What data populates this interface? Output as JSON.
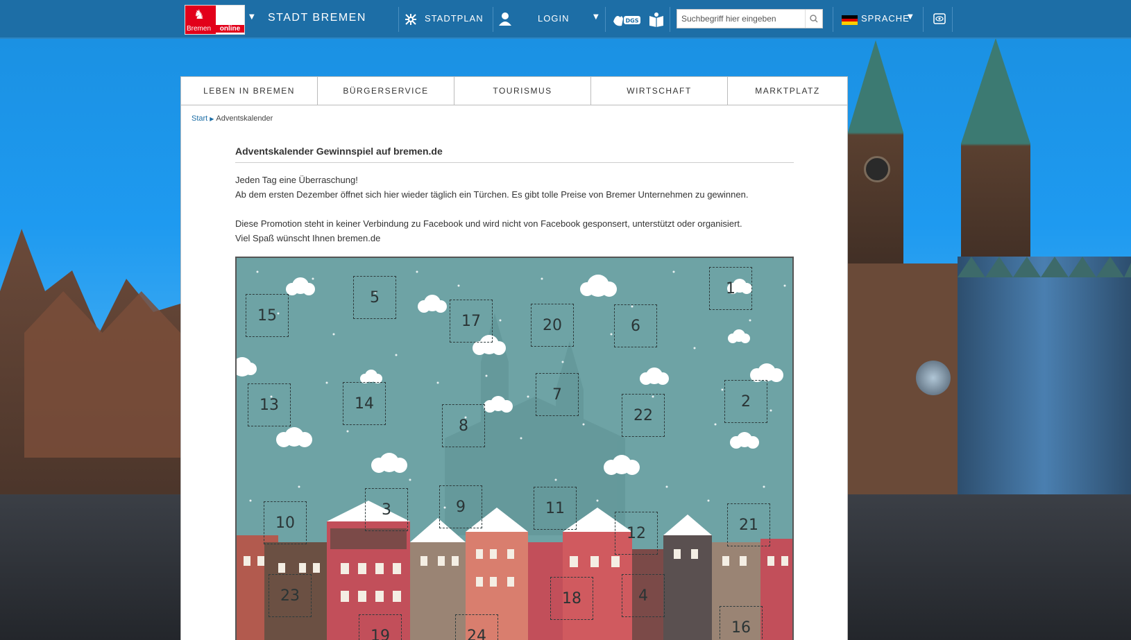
{
  "header": {
    "logo_text_left": "Bremen",
    "logo_text_right": "online",
    "site_title": "STADT BREMEN",
    "stadtplan_label": "STADTPLAN",
    "login_label": "LOGIN",
    "dgs_label": "DGS",
    "search_placeholder": "Suchbegriff hier eingeben",
    "language_label": "SPRACHE"
  },
  "nav": {
    "items": [
      {
        "label": "LEBEN IN BREMEN"
      },
      {
        "label": "BÜRGERSERVICE"
      },
      {
        "label": "TOURISMUS"
      },
      {
        "label": "WIRTSCHAFT"
      },
      {
        "label": "MARKTPLATZ"
      }
    ]
  },
  "breadcrumb": {
    "start": "Start",
    "current": "Adventskalender"
  },
  "page": {
    "title": "Adventskalender Gewinnspiel auf bremen.de",
    "paragraph1_line1": "Jeden Tag eine Überraschung!",
    "paragraph1_line2": "Ab dem ersten Dezember öffnet sich hier wieder täglich ein Türchen. Es gibt tolle Preise von Bremer Unternehmen zu gewinnen.",
    "paragraph2_line1": "Diese Promotion steht in keiner Verbindung zu Facebook und wird nicht von Facebook gesponsert, unterstützt oder organisiert.",
    "paragraph2_line2": "Viel Spaß wünscht Ihnen bremen.de"
  },
  "calendar": {
    "doors": [
      "15",
      "5",
      "17",
      "20",
      "6",
      "1",
      "13",
      "14",
      "8",
      "7",
      "22",
      "2",
      "10",
      "3",
      "9",
      "11",
      "12",
      "21",
      "23",
      "18",
      "4",
      "19",
      "24",
      "16"
    ]
  },
  "colors": {
    "topbar": "#1d6ea6",
    "calendar_bg": "#6ea3a5",
    "flag": [
      "#000000",
      "#dd0000",
      "#ffce00"
    ]
  }
}
